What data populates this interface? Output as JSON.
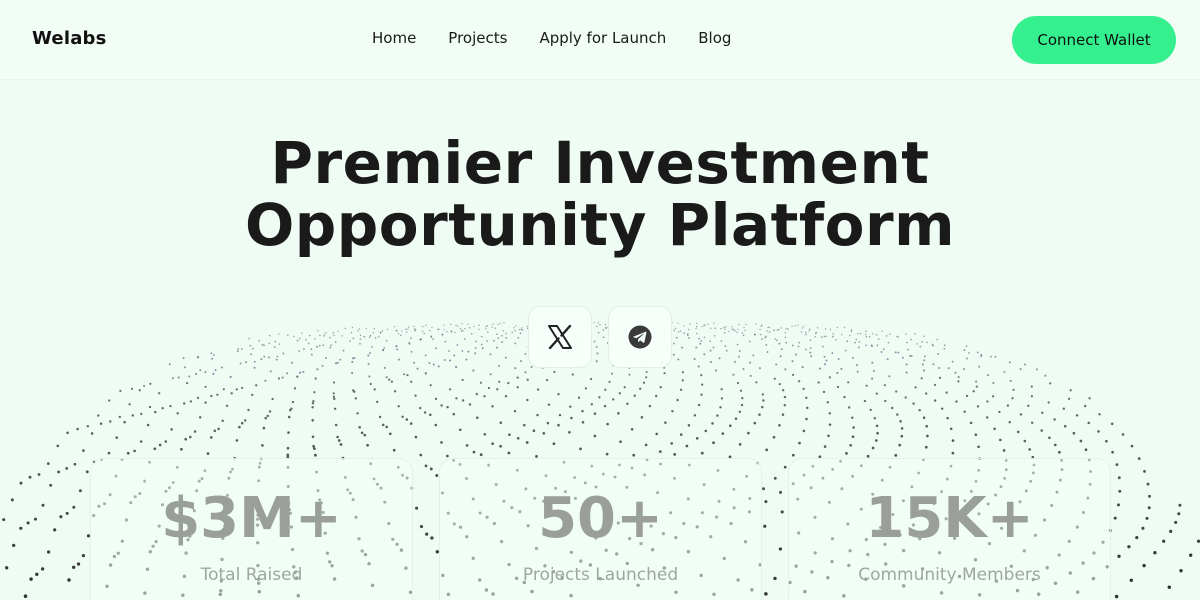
{
  "header": {
    "logo": "Welabs",
    "nav": [
      "Home",
      "Projects",
      "Apply for Launch",
      "Blog"
    ],
    "connect_label": "Connect Wallet"
  },
  "hero": {
    "title_line1": "Premier Investment",
    "title_line2": "Opportunity Platform"
  },
  "socials": [
    {
      "icon": "x-twitter-icon"
    },
    {
      "icon": "telegram-icon"
    }
  ],
  "stats": [
    {
      "value": "$3M+",
      "label": "Total Raised"
    },
    {
      "value": "50+",
      "label": "Projects Launched"
    },
    {
      "value": "15K+",
      "label": "Community Members"
    }
  ],
  "colors": {
    "background": "#effcf4",
    "accent": "#35f08f",
    "stat_text": "#9a9f9c"
  }
}
